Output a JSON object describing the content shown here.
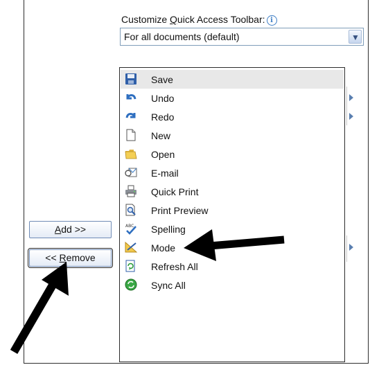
{
  "header": {
    "customize_label_pre": "Customize ",
    "customize_label_u": "Q",
    "customize_label_post": "uick Access Toolbar:",
    "info_glyph": "i"
  },
  "scope_select": {
    "selected": "For all documents (default)"
  },
  "buttons": {
    "add_u": "A",
    "add_post": "dd >>",
    "remove_pre": "<< ",
    "remove_u": "R",
    "remove_post": "emove"
  },
  "toolbar_items": [
    {
      "label": "Save",
      "icon": "save-icon",
      "selected": true,
      "submenu": false
    },
    {
      "label": "Undo",
      "icon": "undo-icon",
      "selected": false,
      "submenu": true
    },
    {
      "label": "Redo",
      "icon": "redo-icon",
      "selected": false,
      "submenu": true
    },
    {
      "label": "New",
      "icon": "new-document-icon",
      "selected": false,
      "submenu": false
    },
    {
      "label": "Open",
      "icon": "open-folder-icon",
      "selected": false,
      "submenu": false
    },
    {
      "label": "E-mail",
      "icon": "email-icon",
      "selected": false,
      "submenu": false
    },
    {
      "label": "Quick Print",
      "icon": "printer-icon",
      "selected": false,
      "submenu": false
    },
    {
      "label": "Print Preview",
      "icon": "print-preview-icon",
      "selected": false,
      "submenu": false
    },
    {
      "label": "Spelling",
      "icon": "spelling-icon",
      "selected": false,
      "submenu": false
    },
    {
      "label": "Mode",
      "icon": "design-mode-icon",
      "selected": false,
      "submenu": true
    },
    {
      "label": "Refresh All",
      "icon": "refresh-all-icon",
      "selected": false,
      "submenu": false
    },
    {
      "label": "Sync All",
      "icon": "sync-all-icon",
      "selected": false,
      "submenu": false
    }
  ],
  "annotations": [
    "annotation-arrow-icon",
    "annotation-arrow-icon"
  ],
  "colors": {
    "selection": "#e8e8e8",
    "accent": "#3f7fc6",
    "arrow": "#000000"
  }
}
